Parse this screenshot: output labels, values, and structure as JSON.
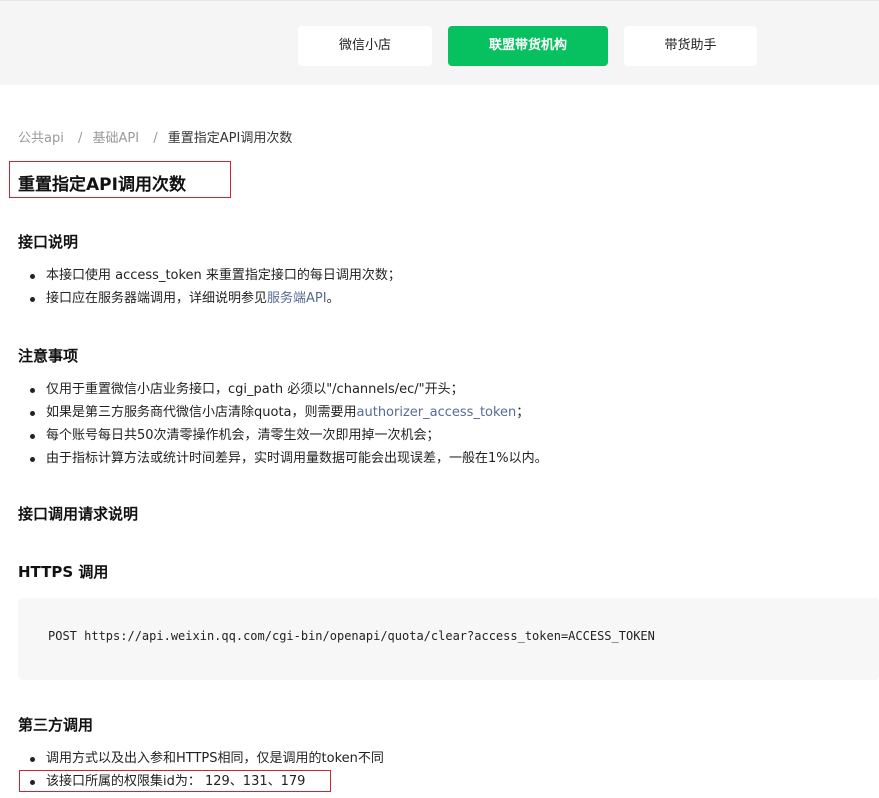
{
  "nav": {
    "tabs": [
      {
        "label": "微信小店"
      },
      {
        "label": "联盟带货机构"
      },
      {
        "label": "带货助手"
      }
    ],
    "active_color": "#07c160"
  },
  "breadcrumb": {
    "items": [
      "公共api",
      "基础API"
    ],
    "separator": "/",
    "current": "重置指定API调用次数"
  },
  "page_title": "重置指定API调用次数",
  "section_intro": {
    "heading": "接口说明",
    "items": [
      {
        "text": "本接口使用 access_token 来重置指定接口的每日调用次数；"
      },
      {
        "prefix": "接口应在服务器端调用，详细说明参见",
        "link": "服务端API",
        "suffix": "。"
      }
    ]
  },
  "section_notes": {
    "heading": "注意事项",
    "items": [
      {
        "text": "仅用于重置微信小店业务接口，cgi_path 必须以\"/channels/ec/\"开头；"
      },
      {
        "prefix": "如果是第三方服务商代微信小店清除quota，则需要用",
        "link": "authorizer_access_token",
        "suffix": "；"
      },
      {
        "text": "每个账号每日共50次清零操作机会，清零生效一次即用掉一次机会；"
      },
      {
        "text": "由于指标计算方法或统计时间差异，实时调用量数据可能会出现误差，一般在1%以内。"
      }
    ]
  },
  "section_request": {
    "heading": "接口调用请求说明"
  },
  "section_https": {
    "heading": "HTTPS 调用",
    "code": "POST https://api.weixin.qq.com/cgi-bin/openapi/quota/clear?access_token=ACCESS_TOKEN"
  },
  "section_third_party": {
    "heading": "第三方调用",
    "items": [
      {
        "text": "调用方式以及出入参和HTTPS相同，仅是调用的token不同"
      },
      {
        "text": "该接口所属的权限集id为： 129、131、179"
      }
    ]
  },
  "colors": {
    "link": "#576b95",
    "highlight_box": "#d0262b"
  }
}
